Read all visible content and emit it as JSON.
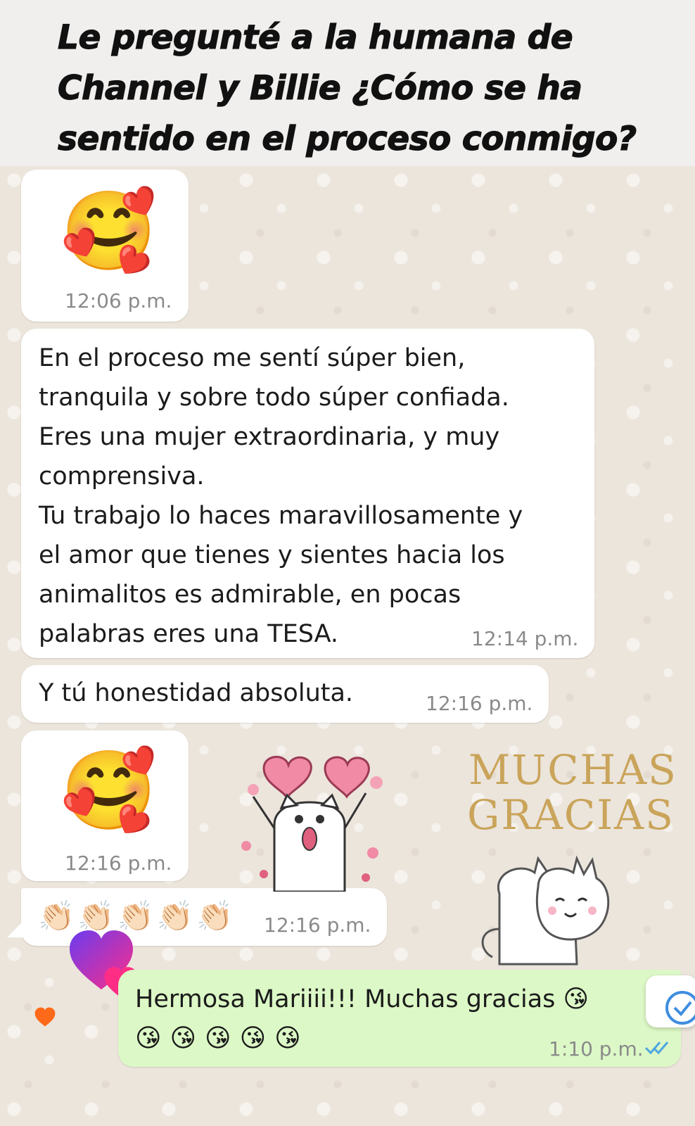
{
  "header": {
    "title": "Le pregunté a la humana de Channel y Billie ¿Cómo se ha sentido en el proceso conmigo?"
  },
  "messages": [
    {
      "id": "m1",
      "direction": "in",
      "type": "emoji",
      "emoji": "🥰",
      "time": "12:06 p.m."
    },
    {
      "id": "m2",
      "direction": "in",
      "type": "text",
      "lines": [
        "En el proceso me sentí súper bien,",
        "tranquila y sobre todo súper confiada.",
        "Eres una mujer extraordinaria, y muy",
        "comprensiva.",
        "Tu trabajo lo haces maravillosamente y",
        "el amor que tienes y sientes hacia los",
        "animalitos es admirable, en pocas",
        "palabras eres una TESA."
      ],
      "time": "12:14 p.m."
    },
    {
      "id": "m3",
      "direction": "in",
      "type": "text",
      "text": "Y tú honestidad absoluta.",
      "time": "12:16 p.m."
    },
    {
      "id": "m4",
      "direction": "in",
      "type": "emoji",
      "emoji": "🥰",
      "time": "12:16 p.m."
    },
    {
      "id": "m5",
      "direction": "in",
      "type": "emoji-row",
      "emoji": "👏🏻👏🏻👏🏻👏🏻👏🏻",
      "time": "12:16 p.m."
    },
    {
      "id": "m6",
      "direction": "out",
      "type": "text",
      "line1": "Hermosa Mariiii!!! Muchas gracias 😘",
      "line2": "😘😘😘😘😘",
      "time": "1:10 p.m.",
      "status": "read"
    }
  ],
  "stickers": {
    "muchas_gracias": {
      "line1": "MUCHAS",
      "line2": "GRACIAS",
      "color": "#c9a45a"
    }
  },
  "colors": {
    "incoming_bubble": "#ffffff",
    "outgoing_bubble": "#dcf8c6",
    "read_tick": "#4fa6e0",
    "wallpaper": "#ece5dc"
  }
}
